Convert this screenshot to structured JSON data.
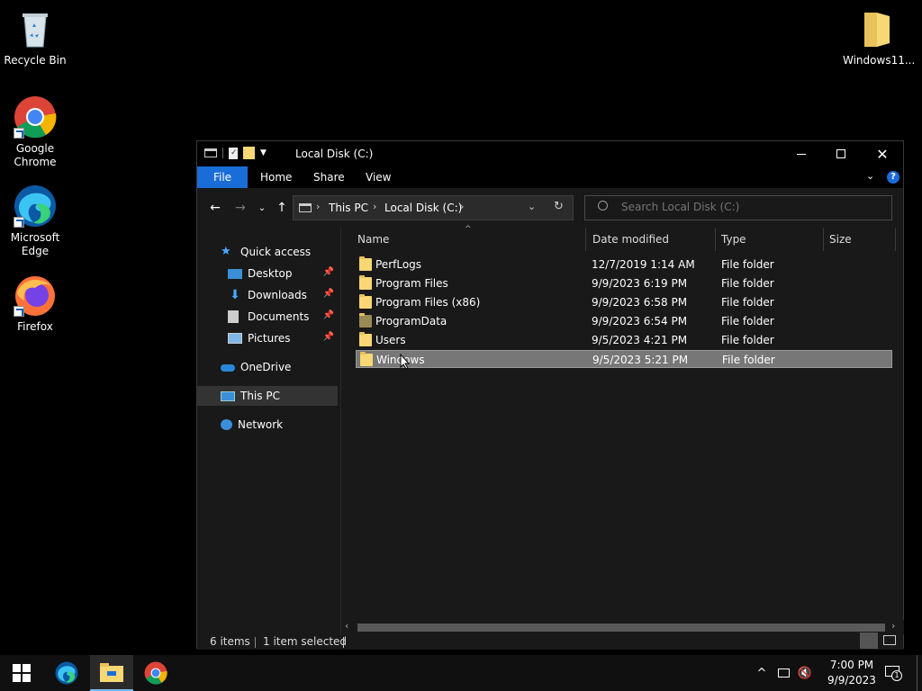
{
  "desktop": {
    "icons": [
      {
        "label": "Recycle Bin"
      },
      {
        "label": "Google Chrome"
      },
      {
        "label": "Microsoft Edge"
      },
      {
        "label": "Firefox"
      },
      {
        "label": "Windows11..."
      }
    ]
  },
  "window": {
    "title": "Local Disk (C:)",
    "ribbon_tabs": [
      "File",
      "Home",
      "Share",
      "View"
    ],
    "breadcrumb": [
      "This PC",
      "Local Disk (C:)"
    ],
    "search_placeholder": "Search Local Disk (C:)",
    "nav_pane": {
      "quick_access": "Quick access",
      "pinned": [
        "Desktop",
        "Downloads",
        "Documents",
        "Pictures"
      ],
      "onedrive": "OneDrive",
      "this_pc": "This PC",
      "network": "Network"
    },
    "columns": [
      "Name",
      "Date modified",
      "Type",
      "Size"
    ],
    "files": [
      {
        "name": "PerfLogs",
        "date": "12/7/2019 1:14 AM",
        "type": "File folder",
        "size": ""
      },
      {
        "name": "Program Files",
        "date": "9/9/2023 6:19 PM",
        "type": "File folder",
        "size": ""
      },
      {
        "name": "Program Files (x86)",
        "date": "9/9/2023 6:58 PM",
        "type": "File folder",
        "size": ""
      },
      {
        "name": "ProgramData",
        "date": "9/9/2023 6:54 PM",
        "type": "File folder",
        "size": ""
      },
      {
        "name": "Users",
        "date": "9/5/2023 4:21 PM",
        "type": "File folder",
        "size": ""
      },
      {
        "name": "Windows",
        "date": "9/5/2023 5:21 PM",
        "type": "File folder",
        "size": ""
      }
    ],
    "selected_row": "Windows",
    "status": {
      "item_count": "6 items",
      "selection": "1 item selected"
    }
  },
  "taskbar": {
    "clock_time": "7:00 PM",
    "clock_date": "9/9/2023",
    "notification_count": "1"
  },
  "colors": {
    "accent": "#1a6dd8",
    "folder": "#f8d775",
    "selection": "#777777"
  }
}
